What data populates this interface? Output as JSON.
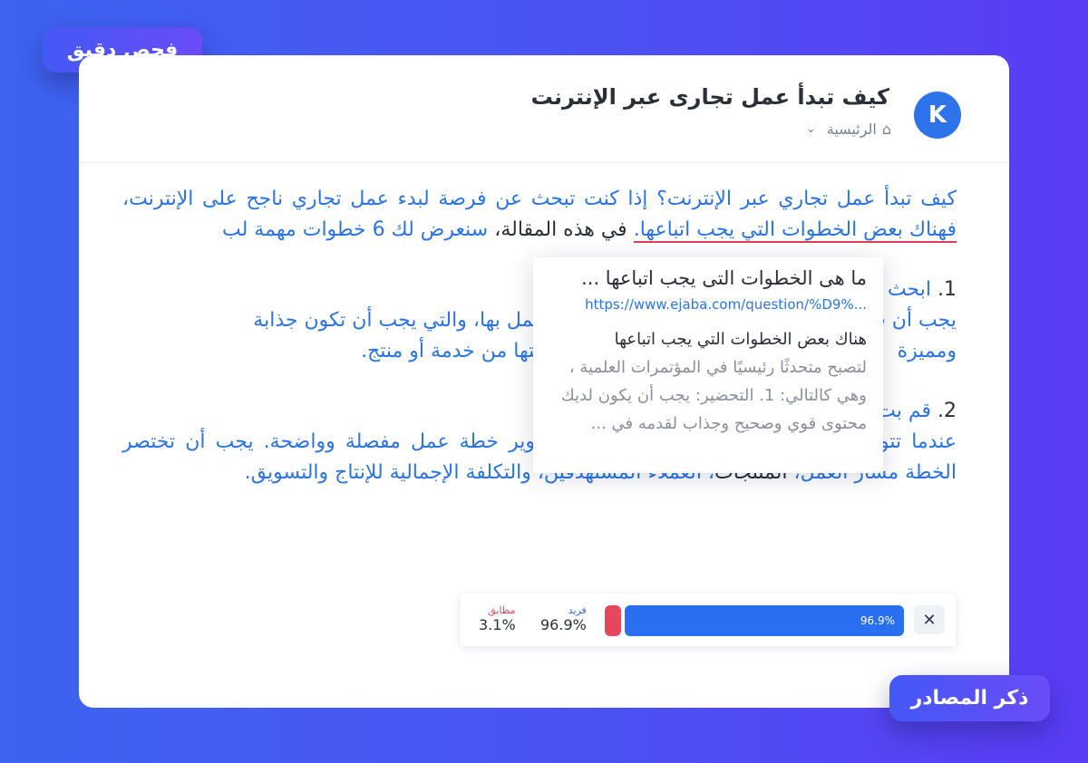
{
  "badges": {
    "top": "فحص دقيق",
    "bottom": "ذكر المصادر"
  },
  "header": {
    "avatar_letter": "K",
    "title": "كيف تبدأ عمل تجارى عبر الإنترنت",
    "breadcrumb": "الرئيسية"
  },
  "article": {
    "p1_a": "كيف تبدأ عمل تجاري عبر الإنترنت؟ إذا كنت تبحث عن فرصة لبدء عمل تجاري ناجح على الإنترنت، ",
    "p1_highlight": "فهناك بعض الخطوات التي يجب اتباعها.",
    "p1_b": " في هذه المقالة،",
    "p1_c": " سنعرض لك 6 خطوات مهمة لب",
    "s1_num": "1.",
    "s1_head": "ابحث ع",
    "s1_body_a": "يجب أن ت",
    "s1_body_b": "تي تريد العمل بها، والتي يجب أن تكون جذابة",
    "s1_body_c": "ومميزة",
    "s1_body_d": "ا تكون حاجتها من خدمة أو منتج.",
    "s2_num": "2.",
    "s2_head": "قم بت",
    "s2_body_a": "عندما تتوصل إلى فكرة المشروع، يجب عليك تطوير خطة عمل مفصلة وواضحة. يجب أن تختصر الخطة مسار العمل، ",
    "s2_body_dark": "المنتجات",
    "s2_body_b": "، العملاء المستهدفين، والتكلفة الإجمالية للإنتاج والتسويق."
  },
  "popup": {
    "title": "ما هى الخطوات التى يجب اتباعها ...",
    "url": "https://www.ejaba.com/question/%D9%...",
    "heading": "هناك بعض الخطوات التي يجب اتباعها",
    "text": "لتصبح متحدثًا رئيسيًا في المؤتمرات العلمية ، وهي كالتالي: 1. التحضير: يجب أن يكون لديك محتوى قوي وصحيح وجذاب لقدمه في ..."
  },
  "stats": {
    "unique_label": "فريد",
    "unique_value": "96.9%",
    "match_label": "مطابق",
    "match_value": "3.1%",
    "bar_label": "96.9%",
    "unique_fraction": 0.969,
    "match_fraction": 0.031,
    "close_symbol": "✕"
  },
  "colors": {
    "accent": "#2a6ff0",
    "match": "#e5475c"
  }
}
